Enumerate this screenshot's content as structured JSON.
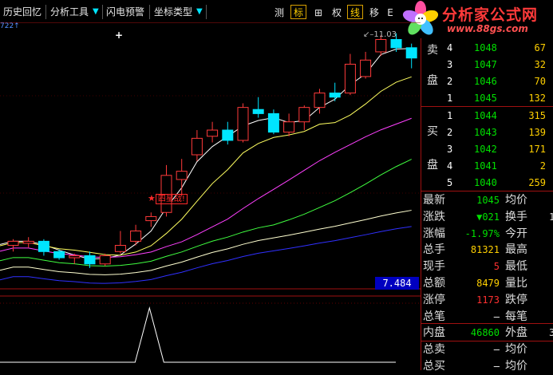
{
  "toolbar": {
    "history": "历史回忆",
    "analysis_tools": "分析工具",
    "flash_alert": "闪电预警",
    "axis_type": "坐标类型",
    "btn_measure": "测",
    "btn_mark": "标",
    "btn_grid": "⊞",
    "btn_rights": "权",
    "btn_line": "线",
    "btn_move": "移",
    "btn_partial": "E"
  },
  "logo": {
    "main": "分析家公式网",
    "sub": "www.88gs.com"
  },
  "chart": {
    "scale_label": "722↑",
    "max_label": "11.03",
    "signal_text": "四星战!",
    "current_price": "7.484",
    "colors": {
      "up": "#ff3a3a",
      "down": "#00e5ff",
      "ma1": "#ffffff",
      "ma2": "#ffff60",
      "ma3": "#ff40ff",
      "ma4": "#40ff40",
      "ma5": "#ffffd0",
      "ma6": "#3030ff"
    }
  },
  "chart_data": {
    "type": "candlestick",
    "candles": [
      {
        "o": 0.06,
        "h": 0.09,
        "l": 0.03,
        "c": 0.08
      },
      {
        "o": 0.07,
        "h": 0.1,
        "l": 0.05,
        "c": 0.08
      },
      {
        "o": 0.08,
        "h": 0.09,
        "l": 0.01,
        "c": 0.03
      },
      {
        "o": 0.03,
        "h": 0.04,
        "l": -0.01,
        "c": 0.0
      },
      {
        "o": 0.0,
        "h": 0.02,
        "l": -0.03,
        "c": 0.01
      },
      {
        "o": 0.01,
        "h": 0.03,
        "l": -0.05,
        "c": -0.03
      },
      {
        "o": -0.03,
        "h": 0.02,
        "l": -0.04,
        "c": 0.01
      },
      {
        "o": 0.03,
        "h": 0.13,
        "l": 0.02,
        "c": 0.06
      },
      {
        "o": 0.08,
        "h": 0.16,
        "l": 0.06,
        "c": 0.13
      },
      {
        "o": 0.18,
        "h": 0.22,
        "l": 0.15,
        "c": 0.2
      },
      {
        "o": 0.22,
        "h": 0.45,
        "l": 0.2,
        "c": 0.4
      },
      {
        "o": 0.38,
        "h": 0.48,
        "l": 0.3,
        "c": 0.42
      },
      {
        "o": 0.5,
        "h": 0.62,
        "l": 0.47,
        "c": 0.58
      },
      {
        "o": 0.59,
        "h": 0.66,
        "l": 0.56,
        "c": 0.62
      },
      {
        "o": 0.62,
        "h": 0.66,
        "l": 0.55,
        "c": 0.57
      },
      {
        "o": 0.57,
        "h": 0.75,
        "l": 0.56,
        "c": 0.73
      },
      {
        "o": 0.72,
        "h": 0.78,
        "l": 0.68,
        "c": 0.7
      },
      {
        "o": 0.7,
        "h": 0.72,
        "l": 0.6,
        "c": 0.61
      },
      {
        "o": 0.61,
        "h": 0.7,
        "l": 0.59,
        "c": 0.66
      },
      {
        "o": 0.66,
        "h": 0.74,
        "l": 0.62,
        "c": 0.73
      },
      {
        "o": 0.73,
        "h": 0.82,
        "l": 0.7,
        "c": 0.8
      },
      {
        "o": 0.8,
        "h": 0.85,
        "l": 0.76,
        "c": 0.78
      },
      {
        "o": 0.8,
        "h": 0.99,
        "l": 0.79,
        "c": 0.94
      },
      {
        "o": 0.88,
        "h": 1.0,
        "l": 0.87,
        "c": 0.96
      },
      {
        "o": 1.0,
        "h": 1.08,
        "l": 0.98,
        "c": 1.06
      },
      {
        "o": 1.06,
        "h": 1.09,
        "l": 1.0,
        "c": 1.02
      },
      {
        "o": 1.02,
        "h": 1.04,
        "l": 0.92,
        "c": 0.97
      }
    ],
    "ylim": [
      -0.12,
      1.12
    ],
    "signal_index": 9,
    "signal_peak_index": 9
  },
  "orderbook": {
    "sell_label_1": "卖",
    "sell_label_2": "盘",
    "buy_label_1": "买",
    "buy_label_2": "盘",
    "sell": [
      {
        "level": "4",
        "price": "1048",
        "vol": "67"
      },
      {
        "level": "3",
        "price": "1047",
        "vol": "32"
      },
      {
        "level": "2",
        "price": "1046",
        "vol": "70"
      },
      {
        "level": "1",
        "price": "1045",
        "vol": "132"
      }
    ],
    "buy": [
      {
        "level": "1",
        "price": "1044",
        "vol": "315"
      },
      {
        "level": "2",
        "price": "1043",
        "vol": "139"
      },
      {
        "level": "3",
        "price": "1042",
        "vol": "171"
      },
      {
        "level": "4",
        "price": "1041",
        "vol": "2"
      },
      {
        "level": "5",
        "price": "1040",
        "vol": "259"
      }
    ]
  },
  "quote": [
    {
      "label": "最新",
      "value": "1045",
      "vclass": "green",
      "label2": "均价",
      "value2": ""
    },
    {
      "label": "涨跌",
      "value": "▼021",
      "vclass": "green",
      "label2": "换手",
      "value2": "1"
    },
    {
      "label": "涨幅",
      "value": "-1.97%",
      "vclass": "green",
      "label2": "今开",
      "value2": ""
    },
    {
      "label": "总手",
      "value": "81321",
      "vclass": "yellow",
      "label2": "最高",
      "value2": ""
    },
    {
      "label": "现手",
      "value": "5",
      "vclass": "red",
      "label2": "最低",
      "value2": ""
    },
    {
      "label": "总额",
      "value": "8479",
      "vclass": "yellow",
      "label2": "量比",
      "value2": ""
    },
    {
      "label": "涨停",
      "value": "1173",
      "vclass": "red",
      "label2": "跌停",
      "value2": ""
    },
    {
      "label": "总笔",
      "value": "–",
      "vclass": "white",
      "label2": "每笔",
      "value2": ""
    },
    {
      "label": "内盘",
      "value": "46860",
      "vclass": "green",
      "label2": "外盘",
      "value2": "3"
    },
    {
      "label": "总卖",
      "value": "–",
      "vclass": "white",
      "label2": "均价",
      "value2": ""
    },
    {
      "label": "总买",
      "value": "–",
      "vclass": "white",
      "label2": "均价",
      "value2": ""
    }
  ]
}
